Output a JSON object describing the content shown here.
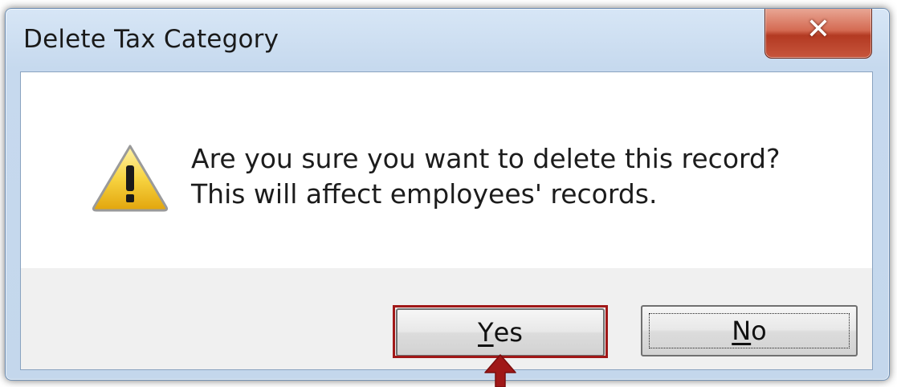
{
  "dialog": {
    "title": "Delete Tax Category",
    "close_glyph": "✕",
    "message_line1": "Are you sure you want to delete this record?",
    "message_line2": "This will affect employees' records.",
    "icon": "warning-icon"
  },
  "buttons": {
    "yes": {
      "mnemonic": "Y",
      "rest": "es"
    },
    "no": {
      "mnemonic": "N",
      "rest": "o"
    }
  },
  "annotation": {
    "highlight_color": "#a01818",
    "arrow_icon": "up-arrow-icon"
  }
}
